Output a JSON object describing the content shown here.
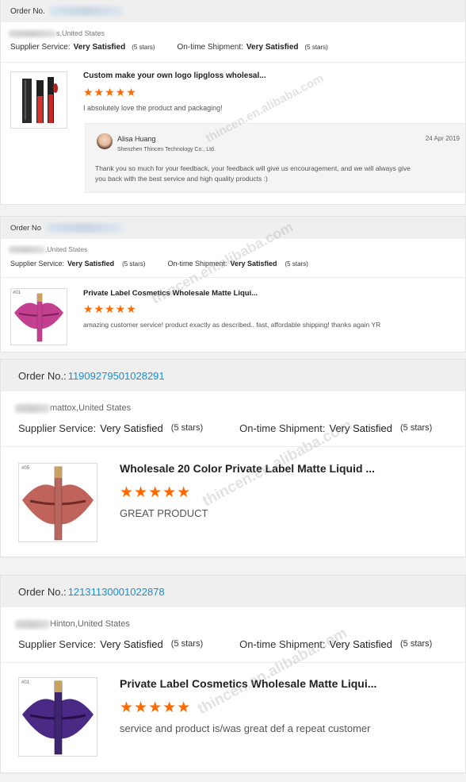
{
  "orders": [
    {
      "order_label": "Order No.",
      "order_number": "",
      "location": "s,United States",
      "supplier_label": "Supplier Service:",
      "supplier_value": "Very Satisfied",
      "supplier_stars": "(5 stars)",
      "shipment_label": "On-time Shipment:",
      "shipment_value": "Very Satisfied",
      "shipment_stars": "(5 stars)",
      "product_title": "Custom make your own logo lipgloss wholesal...",
      "rating_stars": "★★★★★",
      "review_text": "I absolutely love the product and packaging!",
      "reply": {
        "name": "Alisa Huang",
        "company": "Shenzhen Thincen Technology Co., Ltd.",
        "date": "24 Apr 2019",
        "text_line1": "Thank you so much for your feedback, your feedback will give us encouragement, and we will always give",
        "text_line2": "you back with the best service and high quality products :)"
      }
    },
    {
      "order_label": "Order No",
      "order_number": "",
      "location": ",United States",
      "supplier_label": "Supplier Service:",
      "supplier_value": "Very Satisfied",
      "supplier_stars": "(5 stars)",
      "shipment_label": "On-time Shipment:",
      "shipment_value": "Very Satisfied",
      "shipment_stars": "(5 stars)",
      "product_title": "Private Label Cosmetics Wholesale Matte Liqui...",
      "rating_stars": "★★★★★",
      "review_text": "amazing customer service! product exactly as described.. fast, affordable shipping! thanks again YR",
      "thumb_tag": "#01",
      "lip_color": "#c2408f"
    },
    {
      "order_label": "Order No.:",
      "order_number": "11909279501028291",
      "location": "mattox,United States",
      "supplier_label": "Supplier Service:",
      "supplier_value": "Very Satisfied",
      "supplier_stars": "(5 stars)",
      "shipment_label": "On-time Shipment:",
      "shipment_value": "Very Satisfied",
      "shipment_stars": "(5 stars)",
      "product_title": "Wholesale 20 Color Private Label Matte Liquid ...",
      "rating_stars": "★★★★★",
      "review_text": "GREAT PRODUCT",
      "thumb_tag": "#05",
      "lip_color": "#c0645b"
    },
    {
      "order_label": "Order No.:",
      "order_number": "12131130001022878",
      "location": "Hinton,United States",
      "supplier_label": "Supplier Service:",
      "supplier_value": "Very Satisfied",
      "supplier_stars": "(5 stars)",
      "shipment_label": "On-time Shipment:",
      "shipment_value": "Very Satisfied",
      "shipment_stars": "(5 stars)",
      "product_title": "Private Label Cosmetics Wholesale Matte Liqui...",
      "rating_stars": "★★★★★",
      "review_text": "service and product is/was great def a repeat customer",
      "thumb_tag": "#01",
      "lip_color": "#4b2a86"
    }
  ],
  "watermark": "thincen.en.alibaba.com",
  "colors": {
    "accent_link": "#1a8fd0",
    "star": "#ff6a00",
    "header_bg": "#efefef"
  }
}
